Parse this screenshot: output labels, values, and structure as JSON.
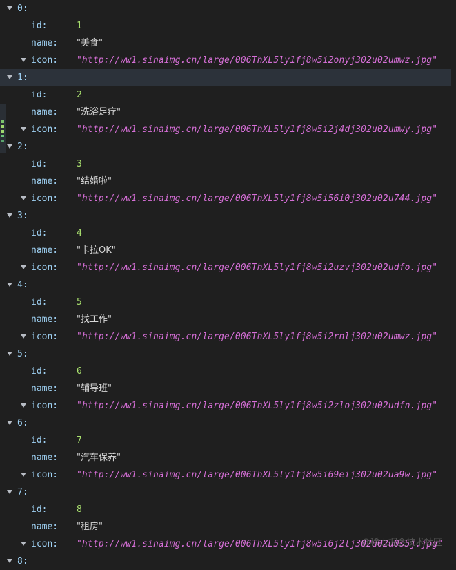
{
  "items": [
    {
      "index": "0:",
      "id_label": "id:",
      "id": "1",
      "name_label": "name:",
      "name": "\"美食\"",
      "icon_label": "icon:",
      "icon_url": "\"http://ww1.sinaimg.cn/large/006ThXL5ly1fj8w5i2onyj302u02umwz.jpg\""
    },
    {
      "index": "1:",
      "id_label": "id:",
      "id": "2",
      "name_label": "name:",
      "name": "\"洗浴足疗\"",
      "icon_label": "icon:",
      "icon_url": "\"http://ww1.sinaimg.cn/large/006ThXL5ly1fj8w5i2j4dj302u02umwy.jpg\""
    },
    {
      "index": "2:",
      "id_label": "id:",
      "id": "3",
      "name_label": "name:",
      "name": "\"结婚啦\"",
      "icon_label": "icon:",
      "icon_url": "\"http://ww1.sinaimg.cn/large/006ThXL5ly1fj8w5i56i0j302u02u744.jpg\""
    },
    {
      "index": "3:",
      "id_label": "id:",
      "id": "4",
      "name_label": "name:",
      "name": "\"卡拉OK\"",
      "icon_label": "icon:",
      "icon_url": "\"http://ww1.sinaimg.cn/large/006ThXL5ly1fj8w5i2uzvj302u02udfo.jpg\""
    },
    {
      "index": "4:",
      "id_label": "id:",
      "id": "5",
      "name_label": "name:",
      "name": "\"找工作\"",
      "icon_label": "icon:",
      "icon_url": "\"http://ww1.sinaimg.cn/large/006ThXL5ly1fj8w5i2rnlj302u02umwz.jpg\""
    },
    {
      "index": "5:",
      "id_label": "id:",
      "id": "6",
      "name_label": "name:",
      "name": "\"辅导班\"",
      "icon_label": "icon:",
      "icon_url": "\"http://ww1.sinaimg.cn/large/006ThXL5ly1fj8w5i2zloj302u02udfn.jpg\""
    },
    {
      "index": "6:",
      "id_label": "id:",
      "id": "7",
      "name_label": "name:",
      "name": "\"汽车保养\"",
      "icon_label": "icon:",
      "icon_url": "\"http://ww1.sinaimg.cn/large/006ThXL5ly1fj8w5i69eij302u02ua9w.jpg\""
    },
    {
      "index": "7:",
      "id_label": "id:",
      "id": "8",
      "name_label": "name:",
      "name": "\"租房\"",
      "icon_label": "icon:",
      "icon_url": "\"http://ww1.sinaimg.cn/large/006ThXL5ly1fj8w5i6j2lj302u02u0s5j.jpg\""
    }
  ],
  "partial_index": "8:",
  "watermark": "@稀土掘金技术社区",
  "ui": {
    "expand_icon": "triangle-down",
    "selected_index": "1"
  }
}
